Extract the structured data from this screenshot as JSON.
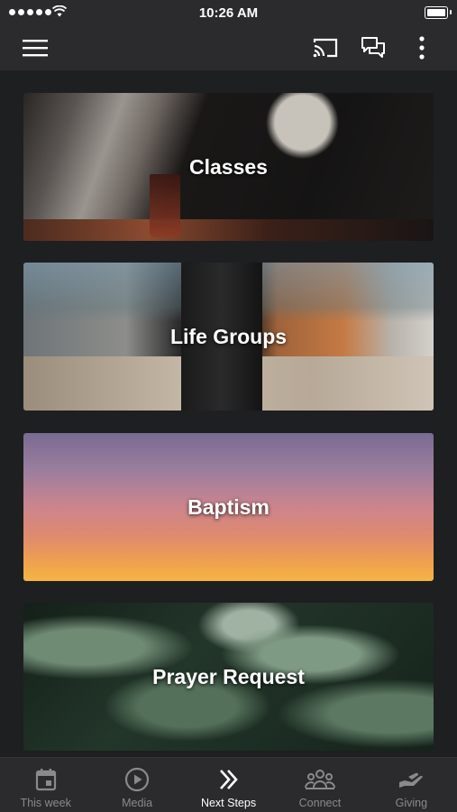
{
  "status_bar": {
    "time": "10:26 AM"
  },
  "cards": [
    {
      "title": "Classes"
    },
    {
      "title": "Life Groups"
    },
    {
      "title": "Baptism"
    },
    {
      "title": "Prayer Request"
    }
  ],
  "bottom_nav": {
    "items": [
      {
        "label": "This week",
        "icon": "calendar-icon",
        "active": false
      },
      {
        "label": "Media",
        "icon": "play-circle-icon",
        "active": false
      },
      {
        "label": "Next Steps",
        "icon": "double-chevron-right-icon",
        "active": true
      },
      {
        "label": "Connect",
        "icon": "group-icon",
        "active": false
      },
      {
        "label": "Giving",
        "icon": "giving-hand-icon",
        "active": false
      }
    ]
  },
  "colors": {
    "background": "#1e1f21",
    "bar": "#2b2b2d",
    "inactive": "#8a8a8c",
    "active": "#ffffff"
  }
}
